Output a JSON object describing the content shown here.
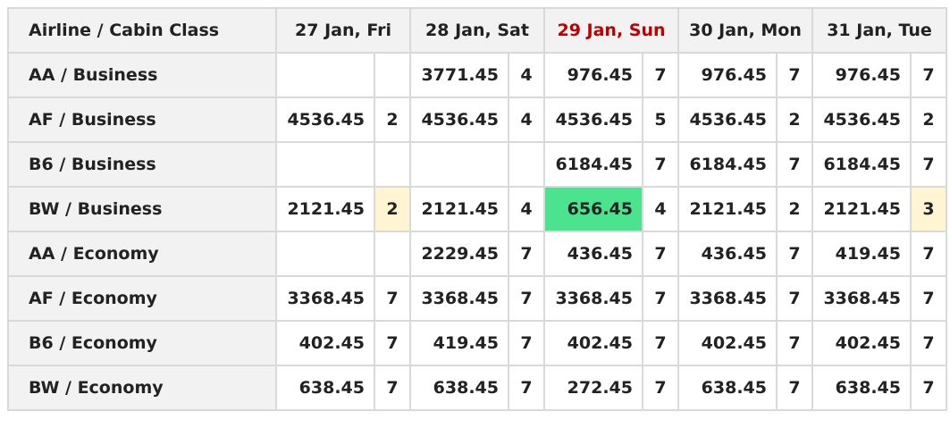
{
  "table": {
    "corner_label": "Airline / Cabin Class",
    "highlight_date_color": "#c00000",
    "cheapest_color": "#4be38e",
    "low_seats_color": "#fff5d2",
    "dates": [
      {
        "label": "27 Jan, Fri",
        "highlight": false
      },
      {
        "label": "28 Jan, Sat",
        "highlight": false
      },
      {
        "label": "29 Jan, Sun",
        "highlight": true
      },
      {
        "label": "30 Jan, Mon",
        "highlight": false
      },
      {
        "label": "31 Jan, Tue",
        "highlight": false
      }
    ],
    "rows": [
      {
        "label": "AA / Business",
        "cells": [
          {
            "price": "",
            "seats": ""
          },
          {
            "price": "3771.45",
            "seats": "4"
          },
          {
            "price": "976.45",
            "seats": "7"
          },
          {
            "price": "976.45",
            "seats": "7"
          },
          {
            "price": "976.45",
            "seats": "7"
          }
        ]
      },
      {
        "label": "AF / Business",
        "cells": [
          {
            "price": "4536.45",
            "seats": "2"
          },
          {
            "price": "4536.45",
            "seats": "4"
          },
          {
            "price": "4536.45",
            "seats": "5"
          },
          {
            "price": "4536.45",
            "seats": "2"
          },
          {
            "price": "4536.45",
            "seats": "2"
          }
        ]
      },
      {
        "label": "B6 / Business",
        "cells": [
          {
            "price": "",
            "seats": ""
          },
          {
            "price": "",
            "seats": ""
          },
          {
            "price": "6184.45",
            "seats": "7"
          },
          {
            "price": "6184.45",
            "seats": "7"
          },
          {
            "price": "6184.45",
            "seats": "7"
          }
        ]
      },
      {
        "label": "BW / Business",
        "cells": [
          {
            "price": "2121.45",
            "seats": "2",
            "seats_warn": true
          },
          {
            "price": "2121.45",
            "seats": "4"
          },
          {
            "price": "656.45",
            "seats": "4",
            "cheapest": true
          },
          {
            "price": "2121.45",
            "seats": "2"
          },
          {
            "price": "2121.45",
            "seats": "3",
            "seats_warn": true
          }
        ]
      },
      {
        "label": "AA / Economy",
        "cells": [
          {
            "price": "",
            "seats": ""
          },
          {
            "price": "2229.45",
            "seats": "7"
          },
          {
            "price": "436.45",
            "seats": "7"
          },
          {
            "price": "436.45",
            "seats": "7"
          },
          {
            "price": "419.45",
            "seats": "7"
          }
        ]
      },
      {
        "label": "AF / Economy",
        "cells": [
          {
            "price": "3368.45",
            "seats": "7"
          },
          {
            "price": "3368.45",
            "seats": "7"
          },
          {
            "price": "3368.45",
            "seats": "7"
          },
          {
            "price": "3368.45",
            "seats": "7"
          },
          {
            "price": "3368.45",
            "seats": "7"
          }
        ]
      },
      {
        "label": "B6 / Economy",
        "cells": [
          {
            "price": "402.45",
            "seats": "7"
          },
          {
            "price": "419.45",
            "seats": "7"
          },
          {
            "price": "402.45",
            "seats": "7"
          },
          {
            "price": "402.45",
            "seats": "7"
          },
          {
            "price": "402.45",
            "seats": "7"
          }
        ]
      },
      {
        "label": "BW / Economy",
        "cells": [
          {
            "price": "638.45",
            "seats": "7"
          },
          {
            "price": "638.45",
            "seats": "7"
          },
          {
            "price": "272.45",
            "seats": "7"
          },
          {
            "price": "638.45",
            "seats": "7"
          },
          {
            "price": "638.45",
            "seats": "7"
          }
        ]
      }
    ]
  }
}
